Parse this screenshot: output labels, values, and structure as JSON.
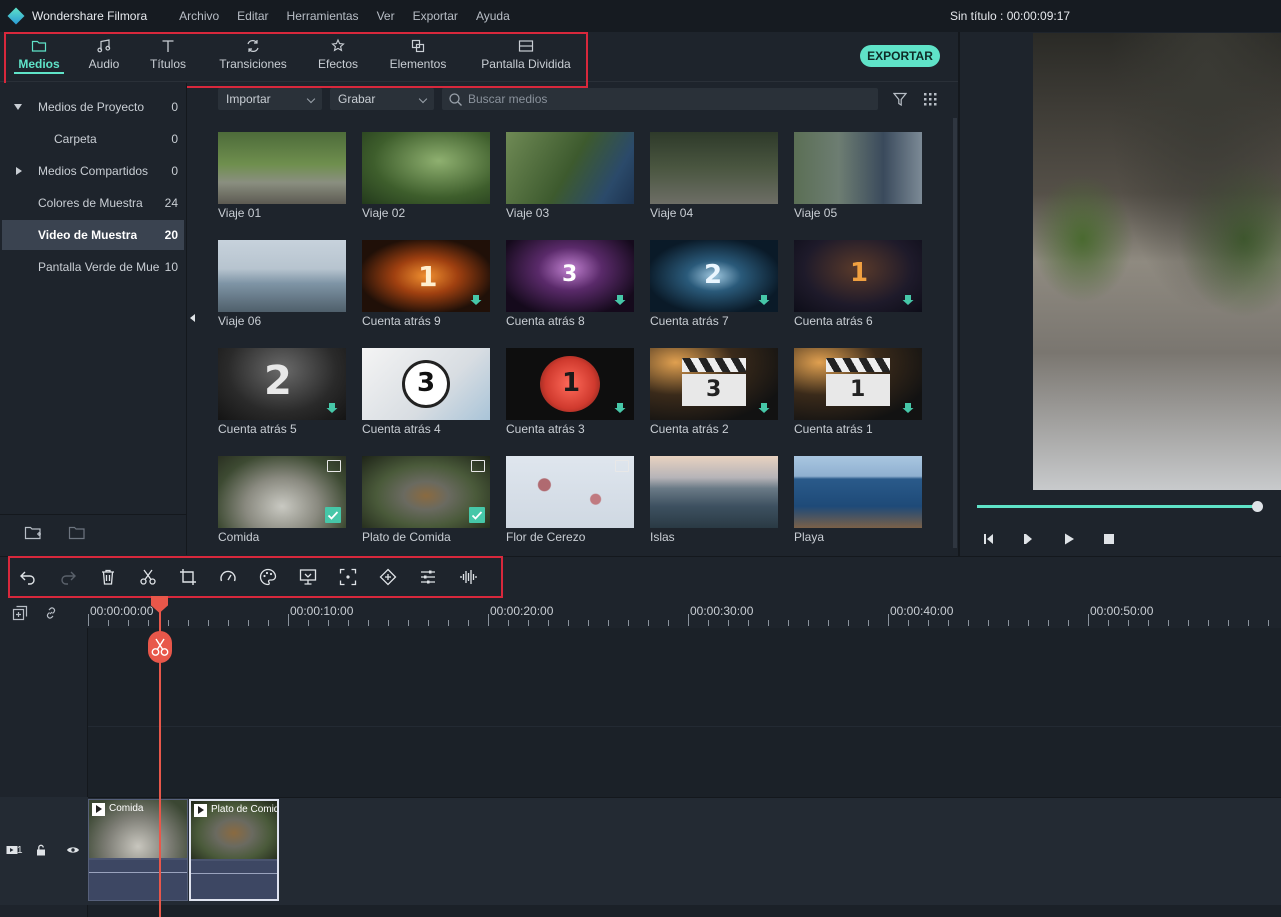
{
  "app": {
    "name": "Wondershare Filmora",
    "document_title": "Sin título : 00:00:09:17"
  },
  "menu": [
    "Archivo",
    "Editar",
    "Herramientas",
    "Ver",
    "Exportar",
    "Ayuda"
  ],
  "tabs": [
    {
      "label": "Medios",
      "icon": "folder-icon",
      "active": true
    },
    {
      "label": "Audio",
      "icon": "music-note-icon"
    },
    {
      "label": "Títulos",
      "icon": "text-icon"
    },
    {
      "label": "Transiciones",
      "icon": "transition-icon"
    },
    {
      "label": "Efectos",
      "icon": "effects-icon"
    },
    {
      "label": "Elementos",
      "icon": "elements-icon"
    },
    {
      "label": "Pantalla Dividida",
      "icon": "split-screen-icon"
    }
  ],
  "export_label": "EXPORTAR",
  "sidebar": [
    {
      "label": "Medios de Proyecto",
      "count": "0"
    },
    {
      "label": "Carpeta",
      "count": "0"
    },
    {
      "label": "Medios Compartidos",
      "count": "0"
    },
    {
      "label": "Colores de Muestra",
      "count": "24"
    },
    {
      "label": "Video de Muestra",
      "count": "20",
      "active": true
    },
    {
      "label": "Pantalla Verde de Muestra",
      "count": "10"
    }
  ],
  "media_bar": {
    "import_label": "Importar",
    "record_label": "Grabar",
    "search_placeholder": "Buscar medios"
  },
  "media": [
    "Viaje 01",
    "Viaje 02",
    "Viaje 03",
    "Viaje 04",
    "Viaje 05",
    "Viaje 06",
    "Cuenta atrás 9",
    "Cuenta atrás 8",
    "Cuenta atrás 7",
    "Cuenta atrás 6",
    "Cuenta atrás 5",
    "Cuenta atrás 4",
    "Cuenta atrás 3",
    "Cuenta atrás 2",
    "Cuenta atrás 1",
    "Comida",
    "Plato de Comida",
    "Flor de Cerezo",
    "Islas",
    "Playa"
  ],
  "countdown_digits": {
    "c9": "1",
    "c8": "3",
    "c7": "2",
    "c6": "1",
    "c5": "2",
    "c4": "3",
    "c3": "1",
    "c2": "3",
    "c1": "1"
  },
  "preview": {
    "progress": 0.99
  },
  "timeline": {
    "ruler": [
      "00:00:00:00",
      "00:00:10:00",
      "00:00:20:00",
      "00:00:30:00",
      "00:00:40:00",
      "00:00:50:00"
    ],
    "track_label": "1",
    "clips": [
      "Comida",
      "Plato de Comida"
    ]
  },
  "colors": {
    "accent": "#5fe3c8",
    "highlight": "#d8283c",
    "playhead": "#e8574a"
  }
}
